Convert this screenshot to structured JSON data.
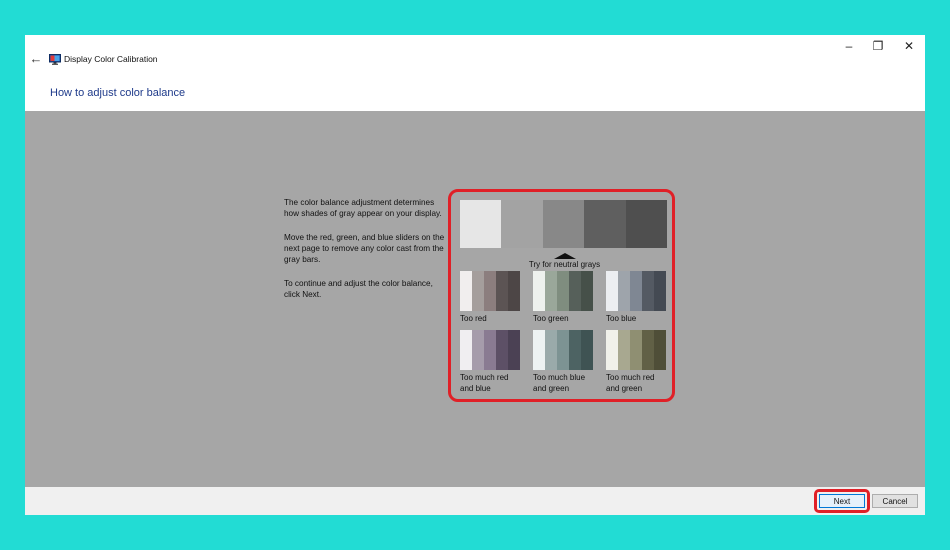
{
  "window": {
    "title": "Display Color Calibration",
    "back_icon": "←",
    "minimize_icon": "–",
    "maximize_icon": "❐",
    "close_icon": "✕"
  },
  "page": {
    "heading": "How to adjust color balance"
  },
  "instructions": [
    "The color balance adjustment determines how shades of gray appear on your display.",
    "Move the red, green, and blue sliders on the next page to remove any color cast from the gray bars.",
    "To continue and adjust the color balance, click Next."
  ],
  "gray_strip": {
    "colors": [
      "#e6e6e6",
      "#a3a3a3",
      "#888888",
      "#5f5f5f",
      "#4f4f4f"
    ],
    "label": "Try for neutral grays"
  },
  "samples": [
    {
      "label": "Too red",
      "colors": [
        "#f1eeee",
        "#a59e9c",
        "#8c7e7e",
        "#5c5454",
        "#4d4646"
      ]
    },
    {
      "label": "Too green",
      "colors": [
        "#eef1ee",
        "#9aa79a",
        "#7f8d7f",
        "#56605a",
        "#465049"
      ]
    },
    {
      "label": "Too blue",
      "colors": [
        "#eceef1",
        "#9ea4ab",
        "#7f8793",
        "#545a63",
        "#444a53"
      ]
    },
    {
      "label": "Too much red and blue",
      "colors": [
        "#f0eef1",
        "#a69cab",
        "#8a7b92",
        "#5d5066",
        "#4b4154"
      ]
    },
    {
      "label": "Too much blue and green",
      "colors": [
        "#edf2f2",
        "#9aaaaa",
        "#7d9393",
        "#4d6363",
        "#3f5353"
      ]
    },
    {
      "label": "Too much red and green",
      "colors": [
        "#f1f1ea",
        "#a8a890",
        "#8f8f72",
        "#616046",
        "#4f4e38"
      ]
    }
  ],
  "footer": {
    "next_label": "Next",
    "cancel_label": "Cancel"
  },
  "accent": {
    "highlight": "#e02027",
    "heading_blue": "#1e3a8a"
  }
}
